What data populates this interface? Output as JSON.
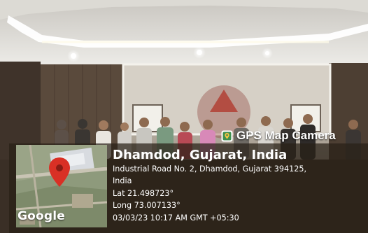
{
  "watermark": {
    "label": "GPS Map Camera",
    "icon": "gps-map-camera-app-icon"
  },
  "map_thumbnail": {
    "pin_icon": "location-pin-icon",
    "attribution": "Google"
  },
  "location": {
    "place": "Dhamdod, Gujarat, India",
    "address_line1": "Industrial Road No. 2, Dhamdod, Gujarat 394125,",
    "address_line2": "India",
    "latitude": "Lat 21.498723°",
    "longitude": "Long 73.007133°",
    "timestamp": "03/03/23 10:17 AM GMT +05:30"
  },
  "colors": {
    "overlay": "#2c2218",
    "pin": "#d93025",
    "ceiling": "#e6e4df",
    "wall": "#bdb5aa",
    "wood_panel": "#4a3c30"
  }
}
